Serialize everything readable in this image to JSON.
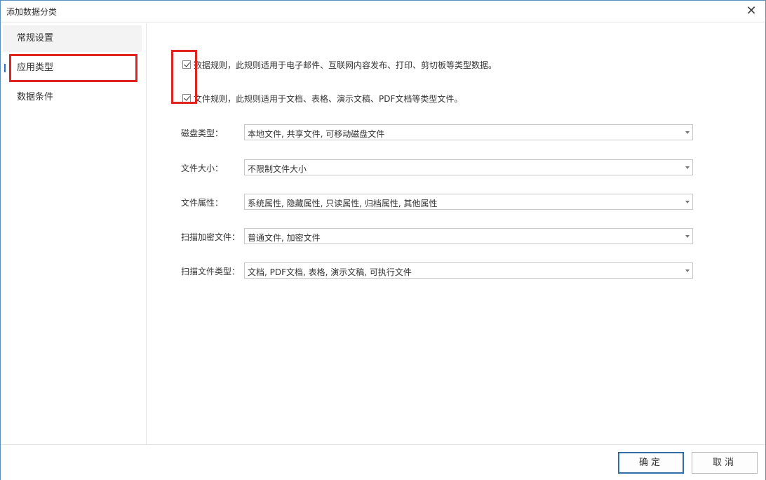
{
  "window": {
    "title": "添加数据分类",
    "close_glyph": "✕"
  },
  "sidebar": {
    "items": [
      {
        "label": "常规设置"
      },
      {
        "label": "应用类型"
      },
      {
        "label": "数据条件"
      }
    ],
    "active_index": 1
  },
  "rules": [
    {
      "label": "数据规则，此规则适用于电子邮件、互联网内容发布、打印、剪切板等类型数据。",
      "checked": true
    },
    {
      "label": "文件规则，此规则适用于文档、表格、演示文稿、PDF文档等类型文件。",
      "checked": true
    }
  ],
  "fields": [
    {
      "label": "磁盘类型：",
      "value": "本地文件, 共享文件, 可移动磁盘文件"
    },
    {
      "label": "文件大小：",
      "value": "不限制文件大小"
    },
    {
      "label": "文件属性：",
      "value": "系统属性, 隐藏属性, 只读属性, 归档属性, 其他属性"
    },
    {
      "label": "扫描加密文件：",
      "value": "普通文件, 加密文件"
    },
    {
      "label": "扫描文件类型：",
      "value": "文档, PDF文档, 表格, 演示文稿, 可执行文件"
    }
  ],
  "buttons": {
    "ok": "确定",
    "cancel": "取消"
  },
  "colors": {
    "highlight": "#e0231f",
    "accent": "#2a6fd6",
    "ok_border": "#2f6ea6"
  }
}
